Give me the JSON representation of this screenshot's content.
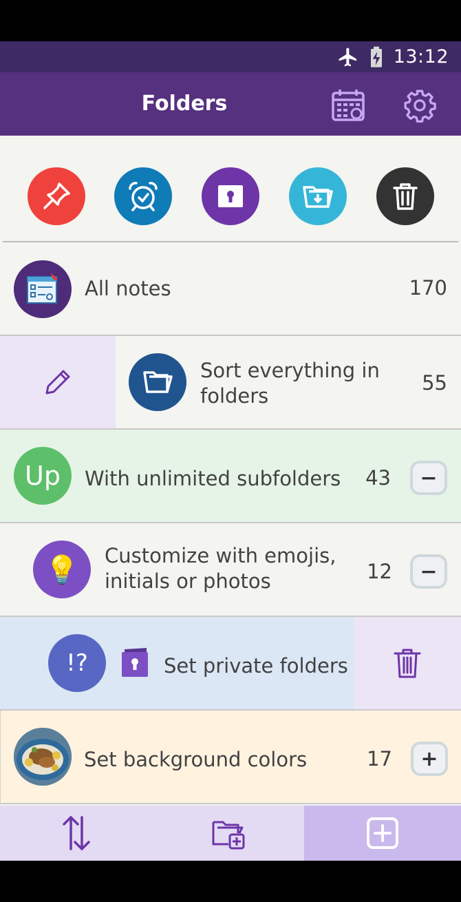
{
  "status_bar": {
    "time": "13:12",
    "icons": [
      "airplane-icon",
      "battery-charging-icon"
    ]
  },
  "app_bar": {
    "title": "Folders",
    "icons": [
      "calendar-icon",
      "settings-icon"
    ]
  },
  "quick_actions": [
    {
      "name": "pin-icon",
      "color": "#f0423c"
    },
    {
      "name": "alarm-clock-icon",
      "color": "#0f7bb7"
    },
    {
      "name": "lock-icon",
      "color": "#6d35a8"
    },
    {
      "name": "archive-folder-icon",
      "color": "#35b6d8"
    },
    {
      "name": "trash-icon",
      "color": "#333333"
    }
  ],
  "folders": [
    {
      "label": "All notes",
      "count": "170",
      "avatar_color": "#4e2c7a",
      "background": "#f4f4f0"
    },
    {
      "label_line1": "Sort everything in",
      "label_line2": "folders",
      "count": "55",
      "avatar_color": "#1f548f",
      "background": "#f4f4f0",
      "swipe_action": "edit-icon",
      "swipe_bg": "#ebe5f5"
    },
    {
      "label": "With unlimited subfolders",
      "count": "43",
      "avatar_text": "Up",
      "avatar_color": "#5ebf6a",
      "background": "#e6f4e8",
      "toggle": "−"
    },
    {
      "label_line1": "Customize with emojis,",
      "label_line2": "initials or photos",
      "count": "12",
      "avatar_color": "#7d4fc4",
      "avatar_emoji": "💡",
      "background": "#f4f4f0",
      "toggle": "−"
    },
    {
      "label": "Set private folders",
      "avatar_text": "!?",
      "avatar_color": "#5867c4",
      "background": "#dbe7f4",
      "swipe_action": "trash-icon",
      "swipe_bg": "#ebe5f5"
    },
    {
      "label": "Set background colors",
      "count": "17",
      "background": "#fff3e0",
      "toggle": "+"
    }
  ],
  "bottom_bar": {
    "icons": [
      "sort-icon",
      "new-folder-icon",
      "add-note-icon"
    ],
    "active_bg": "#c9b9ec"
  }
}
